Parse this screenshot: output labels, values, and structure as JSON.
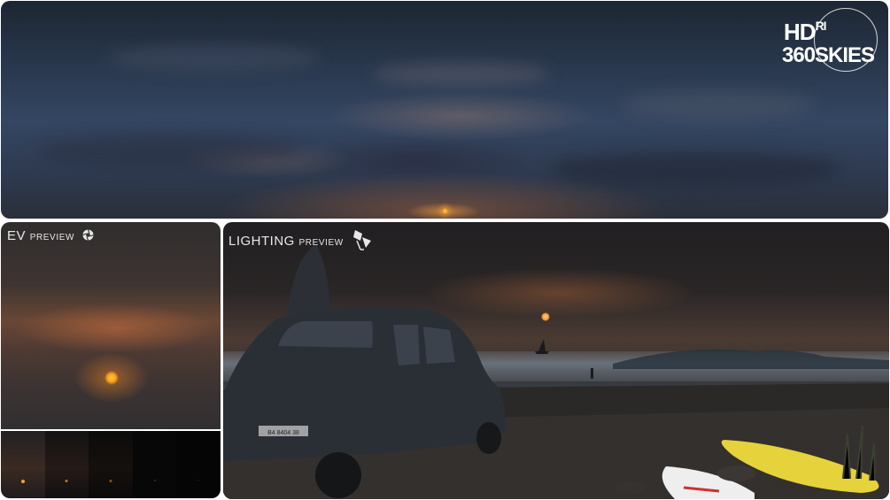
{
  "logo": {
    "line1": "HD",
    "line1_small": "RI",
    "line2": "360SKIES"
  },
  "ev_preview": {
    "title": "EV",
    "subtitle": "PREVIEW",
    "icon": "aperture-icon",
    "exposure_steps": 5
  },
  "lighting_preview": {
    "title": "LIGHTING",
    "subtitle": "PREVIEW",
    "icon": "studio-light-icon"
  },
  "car": {
    "plate": "B4 8404 38"
  },
  "colors": {
    "sky_top": "#1d2633",
    "sunset": "#a05f3c",
    "sun": "#ffb52e",
    "board_yellow": "#e6d23a",
    "board_white": "#eeeeee"
  }
}
